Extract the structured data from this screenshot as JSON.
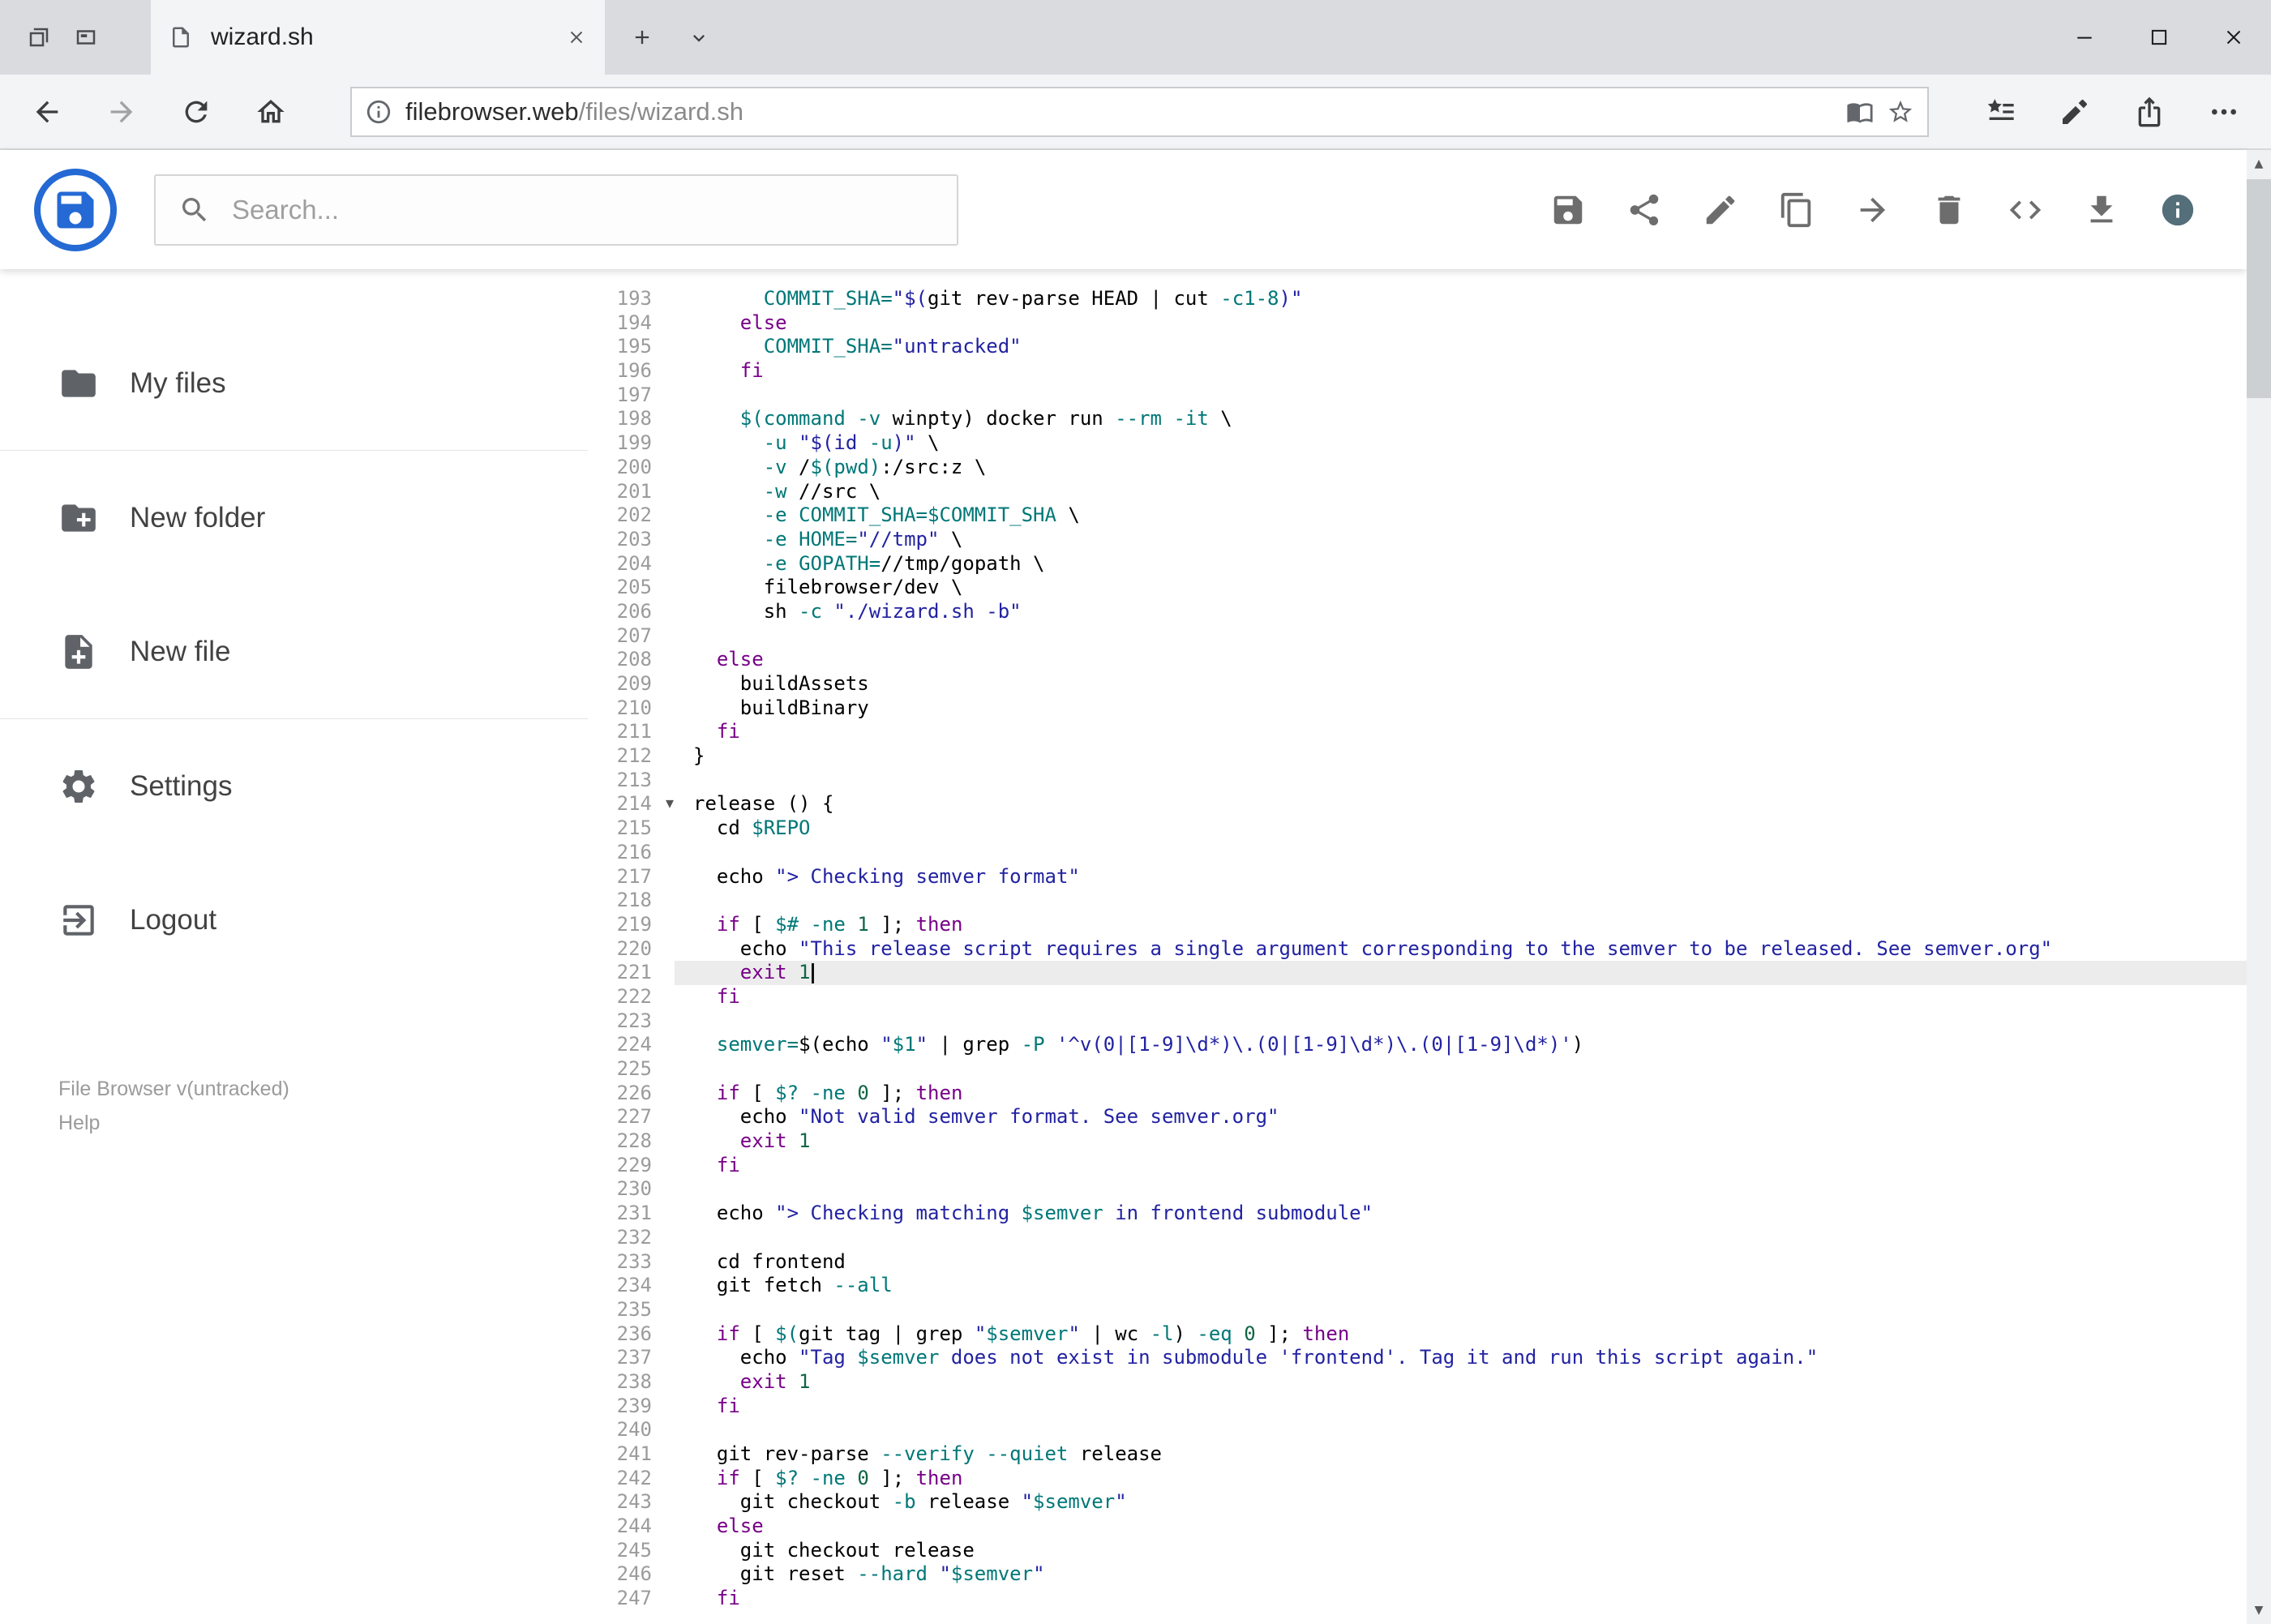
{
  "browser": {
    "tab": {
      "title": "wizard.sh"
    },
    "address": {
      "domain": "filebrowser.web",
      "path": "/files/wizard.sh"
    },
    "nav_icons": [
      "back",
      "forward",
      "refresh",
      "home"
    ],
    "address_icons": [
      "info",
      "reading-view",
      "favorite-star"
    ],
    "action_icons": [
      "favorites-hub",
      "annotate-pen",
      "share",
      "more"
    ],
    "window_icons": [
      "minimize",
      "maximize",
      "close"
    ]
  },
  "header": {
    "search_placeholder": "Search...",
    "toolbar_icons": [
      "save",
      "share",
      "edit",
      "copy",
      "move",
      "delete",
      "code",
      "download",
      "info"
    ]
  },
  "sidebar": {
    "items": [
      {
        "label": "My files",
        "icon": "folder"
      },
      {
        "label": "New folder",
        "icon": "create-new-folder"
      },
      {
        "label": "New file",
        "icon": "note-add"
      },
      {
        "label": "Settings",
        "icon": "gear"
      },
      {
        "label": "Logout",
        "icon": "exit"
      }
    ],
    "footer": {
      "version": "File Browser v(untracked)",
      "help": "Help"
    }
  },
  "editor": {
    "active_line": 221,
    "cursor_line": 221,
    "fold_lines": [
      214
    ],
    "lines": [
      {
        "n": 193,
        "segs": [
          [
            "p",
            "      "
          ],
          [
            "v",
            "COMMIT_SHA="
          ],
          [
            "s",
            "\"$("
          ],
          [
            "p",
            "git rev-parse HEAD | cut "
          ],
          [
            "v",
            "-c1-8"
          ],
          [
            "s",
            ")\""
          ]
        ]
      },
      {
        "n": 194,
        "segs": [
          [
            "p",
            "    "
          ],
          [
            "k",
            "else"
          ]
        ]
      },
      {
        "n": 195,
        "segs": [
          [
            "p",
            "      "
          ],
          [
            "v",
            "COMMIT_SHA="
          ],
          [
            "s",
            "\"untracked\""
          ]
        ]
      },
      {
        "n": 196,
        "segs": [
          [
            "p",
            "    "
          ],
          [
            "k",
            "fi"
          ]
        ]
      },
      {
        "n": 197,
        "segs": []
      },
      {
        "n": 198,
        "segs": [
          [
            "p",
            "    "
          ],
          [
            "v",
            "$(command"
          ],
          [
            "p",
            " "
          ],
          [
            "v",
            "-v"
          ],
          [
            "p",
            " winpty) docker run "
          ],
          [
            "v",
            "--rm"
          ],
          [
            "p",
            " "
          ],
          [
            "v",
            "-it"
          ],
          [
            "p",
            " \\"
          ]
        ]
      },
      {
        "n": 199,
        "segs": [
          [
            "p",
            "      "
          ],
          [
            "v",
            "-u"
          ],
          [
            "p",
            " "
          ],
          [
            "s",
            "\"$(id "
          ],
          [
            "v",
            "-u"
          ],
          [
            "s",
            ")\""
          ],
          [
            "p",
            " \\"
          ]
        ]
      },
      {
        "n": 200,
        "segs": [
          [
            "p",
            "      "
          ],
          [
            "v",
            "-v"
          ],
          [
            "p",
            " /"
          ],
          [
            "v",
            "$(pwd)"
          ],
          [
            "p",
            ":/src:z \\"
          ]
        ]
      },
      {
        "n": 201,
        "segs": [
          [
            "p",
            "      "
          ],
          [
            "v",
            "-w"
          ],
          [
            "p",
            " //src \\"
          ]
        ]
      },
      {
        "n": 202,
        "segs": [
          [
            "p",
            "      "
          ],
          [
            "v",
            "-e"
          ],
          [
            "p",
            " "
          ],
          [
            "v",
            "COMMIT_SHA=$COMMIT_SHA"
          ],
          [
            "p",
            " \\"
          ]
        ]
      },
      {
        "n": 203,
        "segs": [
          [
            "p",
            "      "
          ],
          [
            "v",
            "-e"
          ],
          [
            "p",
            " "
          ],
          [
            "v",
            "HOME="
          ],
          [
            "s",
            "\"//tmp\""
          ],
          [
            "p",
            " \\"
          ]
        ]
      },
      {
        "n": 204,
        "segs": [
          [
            "p",
            "      "
          ],
          [
            "v",
            "-e"
          ],
          [
            "p",
            " "
          ],
          [
            "v",
            "GOPATH="
          ],
          [
            "p",
            "//tmp/gopath \\"
          ]
        ]
      },
      {
        "n": 205,
        "segs": [
          [
            "p",
            "      filebrowser/dev \\"
          ]
        ]
      },
      {
        "n": 206,
        "segs": [
          [
            "p",
            "      sh "
          ],
          [
            "v",
            "-c"
          ],
          [
            "p",
            " "
          ],
          [
            "s",
            "\"./wizard.sh -b\""
          ]
        ]
      },
      {
        "n": 207,
        "segs": []
      },
      {
        "n": 208,
        "segs": [
          [
            "p",
            "  "
          ],
          [
            "k",
            "else"
          ]
        ]
      },
      {
        "n": 209,
        "segs": [
          [
            "p",
            "    buildAssets"
          ]
        ]
      },
      {
        "n": 210,
        "segs": [
          [
            "p",
            "    buildBinary"
          ]
        ]
      },
      {
        "n": 211,
        "segs": [
          [
            "p",
            "  "
          ],
          [
            "k",
            "fi"
          ]
        ]
      },
      {
        "n": 212,
        "segs": [
          [
            "p",
            "}"
          ]
        ]
      },
      {
        "n": 213,
        "segs": []
      },
      {
        "n": 214,
        "segs": [
          [
            "p",
            "release () {"
          ]
        ]
      },
      {
        "n": 215,
        "segs": [
          [
            "p",
            "  cd "
          ],
          [
            "v",
            "$REPO"
          ]
        ]
      },
      {
        "n": 216,
        "segs": []
      },
      {
        "n": 217,
        "segs": [
          [
            "p",
            "  echo "
          ],
          [
            "s",
            "\"> Checking semver format\""
          ]
        ]
      },
      {
        "n": 218,
        "segs": []
      },
      {
        "n": 219,
        "segs": [
          [
            "p",
            "  "
          ],
          [
            "k",
            "if"
          ],
          [
            "p",
            " [ "
          ],
          [
            "v",
            "$#"
          ],
          [
            "p",
            " "
          ],
          [
            "v",
            "-ne"
          ],
          [
            "p",
            " "
          ],
          [
            "n",
            "1"
          ],
          [
            "p",
            " ]; "
          ],
          [
            "k",
            "then"
          ]
        ]
      },
      {
        "n": 220,
        "segs": [
          [
            "p",
            "    echo "
          ],
          [
            "s",
            "\"This release script requires a single argument corresponding to the semver to be released. See semver.org\""
          ]
        ]
      },
      {
        "n": 221,
        "segs": [
          [
            "p",
            "    "
          ],
          [
            "k",
            "exit"
          ],
          [
            "p",
            " "
          ],
          [
            "n",
            "1"
          ]
        ]
      },
      {
        "n": 222,
        "segs": [
          [
            "p",
            "  "
          ],
          [
            "k",
            "fi"
          ]
        ]
      },
      {
        "n": 223,
        "segs": []
      },
      {
        "n": 224,
        "segs": [
          [
            "p",
            "  "
          ],
          [
            "v",
            "semver="
          ],
          [
            "p",
            "$(echo "
          ],
          [
            "s",
            "\""
          ],
          [
            "v",
            "$1"
          ],
          [
            "s",
            "\""
          ],
          [
            "p",
            " | grep "
          ],
          [
            "v",
            "-P"
          ],
          [
            "p",
            " "
          ],
          [
            "s",
            "'^v(0|[1-9]\\d*)\\.(0|[1-9]\\d*)\\.(0|[1-9]\\d*)'"
          ],
          [
            "p",
            ")"
          ]
        ]
      },
      {
        "n": 225,
        "segs": []
      },
      {
        "n": 226,
        "segs": [
          [
            "p",
            "  "
          ],
          [
            "k",
            "if"
          ],
          [
            "p",
            " [ "
          ],
          [
            "v",
            "$?"
          ],
          [
            "p",
            " "
          ],
          [
            "v",
            "-ne"
          ],
          [
            "p",
            " "
          ],
          [
            "n",
            "0"
          ],
          [
            "p",
            " ]; "
          ],
          [
            "k",
            "then"
          ]
        ]
      },
      {
        "n": 227,
        "segs": [
          [
            "p",
            "    echo "
          ],
          [
            "s",
            "\"Not valid semver format. See semver.org\""
          ]
        ]
      },
      {
        "n": 228,
        "segs": [
          [
            "p",
            "    "
          ],
          [
            "k",
            "exit"
          ],
          [
            "p",
            " "
          ],
          [
            "n",
            "1"
          ]
        ]
      },
      {
        "n": 229,
        "segs": [
          [
            "p",
            "  "
          ],
          [
            "k",
            "fi"
          ]
        ]
      },
      {
        "n": 230,
        "segs": []
      },
      {
        "n": 231,
        "segs": [
          [
            "p",
            "  echo "
          ],
          [
            "s",
            "\"> Checking matching "
          ],
          [
            "v",
            "$semver"
          ],
          [
            "s",
            " in frontend submodule\""
          ]
        ]
      },
      {
        "n": 232,
        "segs": []
      },
      {
        "n": 233,
        "segs": [
          [
            "p",
            "  cd frontend"
          ]
        ]
      },
      {
        "n": 234,
        "segs": [
          [
            "p",
            "  git fetch "
          ],
          [
            "v",
            "--all"
          ]
        ]
      },
      {
        "n": 235,
        "segs": []
      },
      {
        "n": 236,
        "segs": [
          [
            "p",
            "  "
          ],
          [
            "k",
            "if"
          ],
          [
            "p",
            " [ "
          ],
          [
            "v",
            "$("
          ],
          [
            "p",
            "git tag | grep "
          ],
          [
            "s",
            "\""
          ],
          [
            "v",
            "$semver"
          ],
          [
            "s",
            "\""
          ],
          [
            "p",
            " | wc "
          ],
          [
            "v",
            "-l"
          ],
          [
            "p",
            ") "
          ],
          [
            "v",
            "-eq"
          ],
          [
            "p",
            " "
          ],
          [
            "n",
            "0"
          ],
          [
            "p",
            " ]; "
          ],
          [
            "k",
            "then"
          ]
        ]
      },
      {
        "n": 237,
        "segs": [
          [
            "p",
            "    echo "
          ],
          [
            "s",
            "\"Tag "
          ],
          [
            "v",
            "$semver"
          ],
          [
            "s",
            " does not exist in submodule 'frontend'. Tag it and run this script again.\""
          ]
        ]
      },
      {
        "n": 238,
        "segs": [
          [
            "p",
            "    "
          ],
          [
            "k",
            "exit"
          ],
          [
            "p",
            " "
          ],
          [
            "n",
            "1"
          ]
        ]
      },
      {
        "n": 239,
        "segs": [
          [
            "p",
            "  "
          ],
          [
            "k",
            "fi"
          ]
        ]
      },
      {
        "n": 240,
        "segs": []
      },
      {
        "n": 241,
        "segs": [
          [
            "p",
            "  git rev-parse "
          ],
          [
            "v",
            "--verify"
          ],
          [
            "p",
            " "
          ],
          [
            "v",
            "--quiet"
          ],
          [
            "p",
            " release"
          ]
        ]
      },
      {
        "n": 242,
        "segs": [
          [
            "p",
            "  "
          ],
          [
            "k",
            "if"
          ],
          [
            "p",
            " [ "
          ],
          [
            "v",
            "$?"
          ],
          [
            "p",
            " "
          ],
          [
            "v",
            "-ne"
          ],
          [
            "p",
            " "
          ],
          [
            "n",
            "0"
          ],
          [
            "p",
            " ]; "
          ],
          [
            "k",
            "then"
          ]
        ]
      },
      {
        "n": 243,
        "segs": [
          [
            "p",
            "    git checkout "
          ],
          [
            "v",
            "-b"
          ],
          [
            "p",
            " release "
          ],
          [
            "s",
            "\""
          ],
          [
            "v",
            "$semver"
          ],
          [
            "s",
            "\""
          ]
        ]
      },
      {
        "n": 244,
        "segs": [
          [
            "p",
            "  "
          ],
          [
            "k",
            "else"
          ]
        ]
      },
      {
        "n": 245,
        "segs": [
          [
            "p",
            "    git checkout release"
          ]
        ]
      },
      {
        "n": 246,
        "segs": [
          [
            "p",
            "    git reset "
          ],
          [
            "v",
            "--hard"
          ],
          [
            "p",
            " "
          ],
          [
            "s",
            "\""
          ],
          [
            "v",
            "$semver"
          ],
          [
            "s",
            "\""
          ]
        ]
      },
      {
        "n": 247,
        "segs": [
          [
            "p",
            "  "
          ],
          [
            "k",
            "fi"
          ]
        ]
      }
    ]
  }
}
